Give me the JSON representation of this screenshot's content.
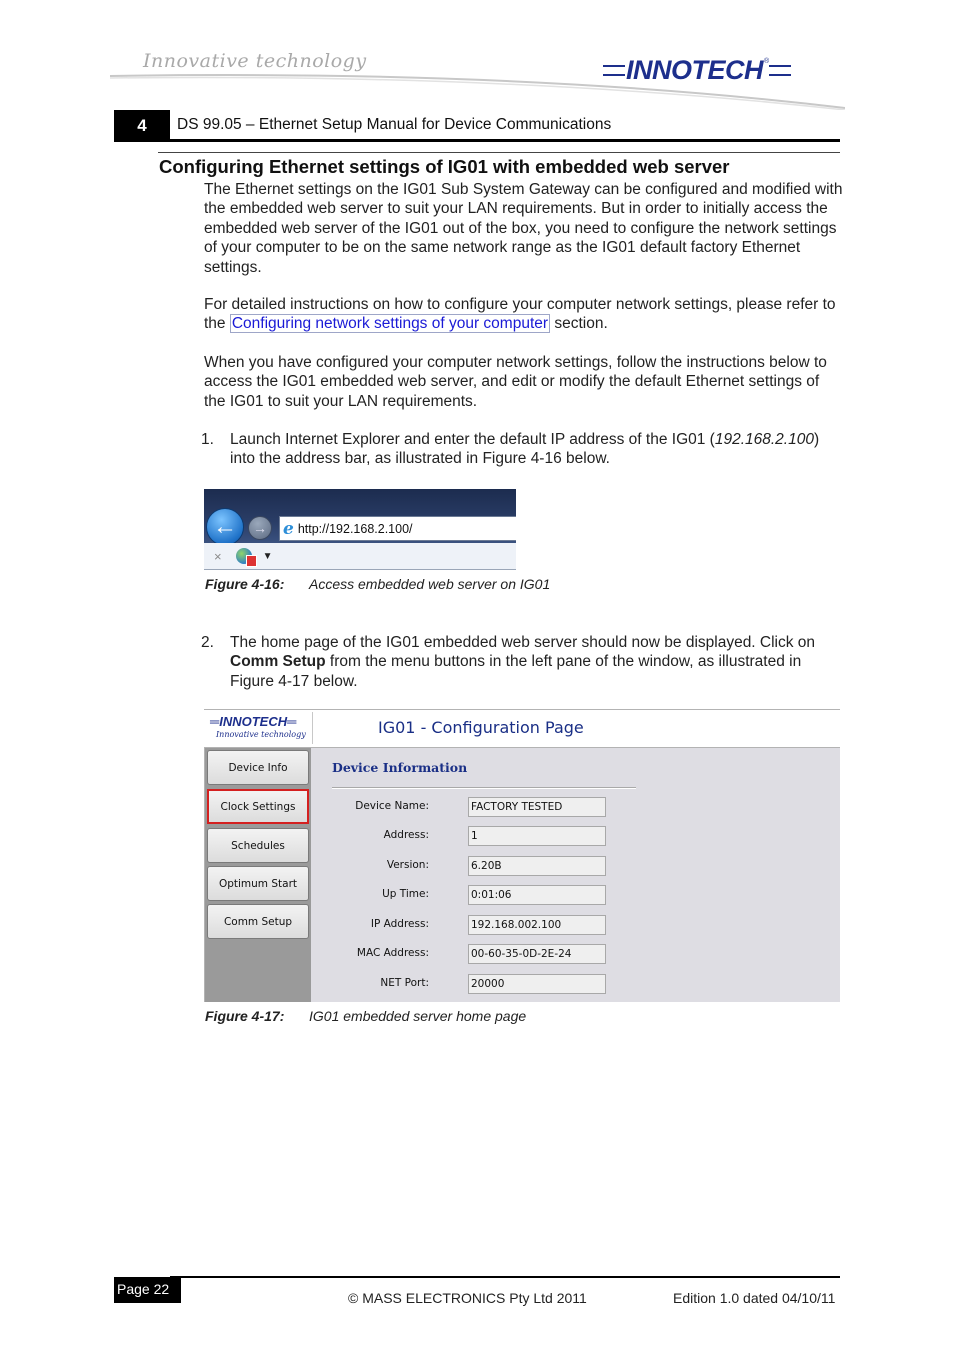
{
  "header": {
    "tagline": "Innovative technology",
    "logo": "INNOTECH",
    "logo_mark": "®",
    "chapter_number": "4",
    "chapter_title": "DS 99.05 – Ethernet Setup Manual for Device Communications"
  },
  "section": {
    "heading": "Configuring Ethernet settings of IG01 with embedded web server",
    "paragraph1": "The Ethernet settings on the IG01 Sub System Gateway can be configured and modified with the embedded web server to suit your LAN requirements.  But in order to initially access the embedded web server of the IG01 out of the box, you need to configure the network settings of your computer to be on the same network range as the IG01 default factory Ethernet settings.",
    "paragraph2_before": "For detailed instructions on how to configure your computer network settings, please refer to the ",
    "paragraph2_link": "Configuring network settings of your computer",
    "paragraph2_after": " section.",
    "paragraph3": "When you have configured your computer network settings, follow the instructions below to access the IG01 embedded web server, and edit or modify the default Ethernet settings of the IG01 to suit your LAN requirements.",
    "steps": [
      {
        "number": "1.",
        "text_before": "Launch Internet Explorer and enter the default IP address of the IG01 (",
        "text_italic": "192.168.2.100",
        "text_after": ") into the address bar, as illustrated in Figure 4-16 below."
      },
      {
        "number": "2.",
        "text_before": "The home page of the IG01 embedded web server should now be displayed.  Click on ",
        "text_bold": "Comm Setup",
        "text_after": " from the menu buttons in the left pane of the window, as illustrated in Figure 4-17 below."
      }
    ]
  },
  "figure16": {
    "browser": {
      "back_icon": "back-arrow-icon",
      "forward_icon": "forward-arrow-icon",
      "url": "http://192.168.2.100/",
      "stop_icon": "×",
      "dropdown_icon": "▼"
    },
    "caption_label": "Figure 4-16:",
    "caption_text": "Access embedded web server on IG01"
  },
  "figure17": {
    "web": {
      "logo": "INNOTECH",
      "logo_sub": "Innovative technology",
      "title": "IG01 - Configuration Page",
      "menu": [
        {
          "label": "Device Info",
          "highlighted": false
        },
        {
          "label": "Clock Settings",
          "highlighted": true
        },
        {
          "label": "Schedules",
          "highlighted": false
        },
        {
          "label": "Optimum Start",
          "highlighted": false
        },
        {
          "label": "Comm Setup",
          "highlighted": false
        }
      ],
      "section_title": "Device Information",
      "fields": [
        {
          "label": "Device Name:",
          "value": "FACTORY TESTED"
        },
        {
          "label": "Address:",
          "value": "1"
        },
        {
          "label": "Version:",
          "value": "6.20B"
        },
        {
          "label": "Up Time:",
          "value": "0:01:06"
        },
        {
          "label": "IP Address:",
          "value": "192.168.002.100"
        },
        {
          "label": "MAC Address:",
          "value": "00-60-35-0D-2E-24"
        },
        {
          "label": "NET Port:",
          "value": "20000"
        }
      ]
    },
    "caption_label": "Figure 4-17:",
    "caption_text": "IG01 embedded server home page"
  },
  "footer": {
    "page": "Page 22",
    "copyright": "©  MASS ELECTRONICS Pty Ltd  2011",
    "edition": "Edition 1.0 dated 04/10/11"
  }
}
